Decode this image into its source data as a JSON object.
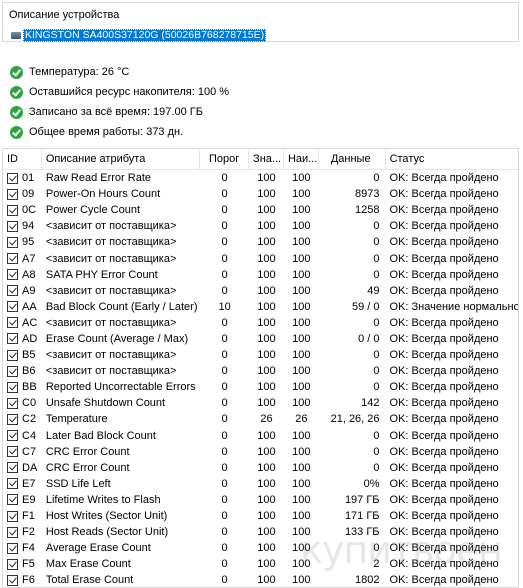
{
  "device": {
    "group_title": "Описание устройства",
    "name": "KINGSTON SA400S37120G (50026B768278715E)"
  },
  "info": [
    {
      "text": "Температура: 26 °C"
    },
    {
      "text": "Оставшийся ресурс накопителя: 100 %"
    },
    {
      "text": "Записано за всё время: 197.00 ГБ"
    },
    {
      "text": "Общее время работы: 373 дн."
    }
  ],
  "table": {
    "headers": {
      "id": "ID",
      "name": "Описание атрибута",
      "threshold": "Порог",
      "value": "Зна...",
      "worst": "Наи...",
      "data": "Данные",
      "status": "Статус"
    },
    "rows": [
      {
        "id": "01",
        "name": "Raw Read Error Rate",
        "thr": "0",
        "val": "100",
        "worst": "100",
        "data": "0",
        "status": "OK: Всегда пройдено"
      },
      {
        "id": "09",
        "name": "Power-On Hours Count",
        "thr": "0",
        "val": "100",
        "worst": "100",
        "data": "8973",
        "status": "OK: Всегда пройдено"
      },
      {
        "id": "0C",
        "name": "Power Cycle Count",
        "thr": "0",
        "val": "100",
        "worst": "100",
        "data": "1258",
        "status": "OK: Всегда пройдено"
      },
      {
        "id": "94",
        "name": "<зависит от поставщика>",
        "thr": "0",
        "val": "100",
        "worst": "100",
        "data": "0",
        "status": "OK: Всегда пройдено"
      },
      {
        "id": "95",
        "name": "<зависит от поставщика>",
        "thr": "0",
        "val": "100",
        "worst": "100",
        "data": "0",
        "status": "OK: Всегда пройдено"
      },
      {
        "id": "A7",
        "name": "<зависит от поставщика>",
        "thr": "0",
        "val": "100",
        "worst": "100",
        "data": "0",
        "status": "OK: Всегда пройдено"
      },
      {
        "id": "A8",
        "name": "SATA PHY Error Count",
        "thr": "0",
        "val": "100",
        "worst": "100",
        "data": "0",
        "status": "OK: Всегда пройдено"
      },
      {
        "id": "A9",
        "name": "<зависит от поставщика>",
        "thr": "0",
        "val": "100",
        "worst": "100",
        "data": "49",
        "status": "OK: Всегда пройдено"
      },
      {
        "id": "AA",
        "name": "Bad Block Count (Early / Later)",
        "thr": "10",
        "val": "100",
        "worst": "100",
        "data": "59 / 0",
        "status": "OK: Значение нормальное"
      },
      {
        "id": "AC",
        "name": "<зависит от поставщика>",
        "thr": "0",
        "val": "100",
        "worst": "100",
        "data": "0",
        "status": "OK: Всегда пройдено"
      },
      {
        "id": "AD",
        "name": "Erase Count (Average / Max)",
        "thr": "0",
        "val": "100",
        "worst": "100",
        "data": "0 / 0",
        "status": "OK: Всегда пройдено"
      },
      {
        "id": "B5",
        "name": "<зависит от поставщика>",
        "thr": "0",
        "val": "100",
        "worst": "100",
        "data": "0",
        "status": "OK: Всегда пройдено"
      },
      {
        "id": "B6",
        "name": "<зависит от поставщика>",
        "thr": "0",
        "val": "100",
        "worst": "100",
        "data": "0",
        "status": "OK: Всегда пройдено"
      },
      {
        "id": "BB",
        "name": "Reported Uncorrectable Errors",
        "thr": "0",
        "val": "100",
        "worst": "100",
        "data": "0",
        "status": "OK: Всегда пройдено"
      },
      {
        "id": "C0",
        "name": "Unsafe Shutdown Count",
        "thr": "0",
        "val": "100",
        "worst": "100",
        "data": "142",
        "status": "OK: Всегда пройдено"
      },
      {
        "id": "C2",
        "name": "Temperature",
        "thr": "0",
        "val": "26",
        "worst": "26",
        "data": "21, 26, 26",
        "status": "OK: Всегда пройдено"
      },
      {
        "id": "C4",
        "name": "Later Bad Block Count",
        "thr": "0",
        "val": "100",
        "worst": "100",
        "data": "0",
        "status": "OK: Всегда пройдено"
      },
      {
        "id": "C7",
        "name": "CRC Error Count",
        "thr": "0",
        "val": "100",
        "worst": "100",
        "data": "0",
        "status": "OK: Всегда пройдено"
      },
      {
        "id": "DA",
        "name": "CRC Error Count",
        "thr": "0",
        "val": "100",
        "worst": "100",
        "data": "0",
        "status": "OK: Всегда пройдено"
      },
      {
        "id": "E7",
        "name": "SSD Life Left",
        "thr": "0",
        "val": "100",
        "worst": "100",
        "data": "0%",
        "status": "OK: Всегда пройдено"
      },
      {
        "id": "E9",
        "name": "Lifetime Writes to Flash",
        "thr": "0",
        "val": "100",
        "worst": "100",
        "data": "197 ГБ",
        "status": "OK: Всегда пройдено"
      },
      {
        "id": "F1",
        "name": "Host Writes (Sector Unit)",
        "thr": "0",
        "val": "100",
        "worst": "100",
        "data": "171 ГБ",
        "status": "OK: Всегда пройдено"
      },
      {
        "id": "F2",
        "name": "Host Reads (Sector Unit)",
        "thr": "0",
        "val": "100",
        "worst": "100",
        "data": "133 ГБ",
        "status": "OK: Всегда пройдено"
      },
      {
        "id": "F4",
        "name": "Average Erase Count",
        "thr": "0",
        "val": "100",
        "worst": "100",
        "data": "0",
        "status": "OK: Всегда пройдено"
      },
      {
        "id": "F5",
        "name": "Max Erase Count",
        "thr": "0",
        "val": "100",
        "worst": "100",
        "data": "2",
        "status": "OK: Всегда пройдено"
      },
      {
        "id": "F6",
        "name": "Total Erase Count",
        "thr": "0",
        "val": "100",
        "worst": "100",
        "data": "1802",
        "status": "OK: Всегда пройдено"
      }
    ]
  },
  "watermark": "купитвоен"
}
